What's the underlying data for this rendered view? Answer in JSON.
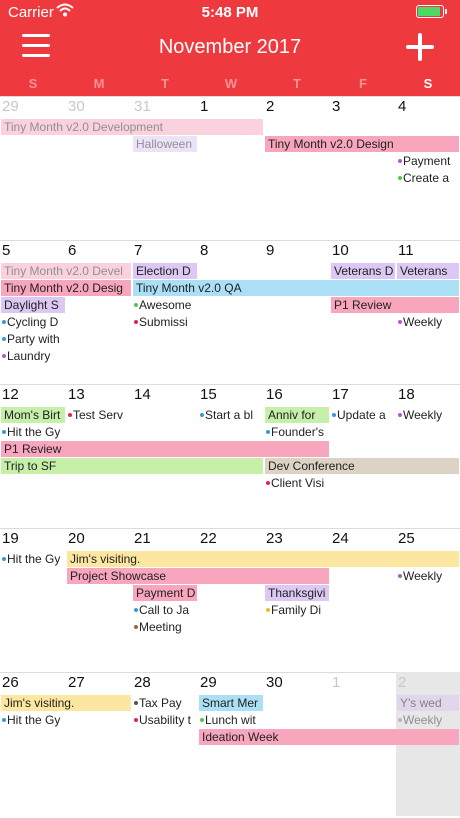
{
  "status": {
    "carrier": "Carrier",
    "time": "5:48 PM",
    "battery_level": 0.9
  },
  "header": {
    "title": "November 2017"
  },
  "weekdays": [
    "S",
    "M",
    "T",
    "W",
    "T",
    "F",
    "S"
  ],
  "colors": {
    "header": "#ee3a3e",
    "pink": "#f7a6bd",
    "purple": "#dcc8f3",
    "blue": "#aadff5",
    "green": "#c6efa9",
    "yellow": "#fbe7a0",
    "tan": "#ddd3c5",
    "dot_purple": "#b35bc9",
    "dot_green": "#4cc74d",
    "dot_blue": "#3a98d8",
    "dot_red": "#dc2755",
    "dot_gray": "#555555",
    "dot_brown": "#8a6a4a",
    "dot_yellow": "#f1b92e"
  },
  "weeks": [
    {
      "days": [
        {
          "num": "29",
          "dim": true
        },
        {
          "num": "30",
          "dim": true
        },
        {
          "num": "31",
          "dim": true
        },
        {
          "num": "1"
        },
        {
          "num": "2"
        },
        {
          "num": "3"
        },
        {
          "num": "4"
        }
      ],
      "bars": [
        {
          "label": "Tiny Month v2.0 Development",
          "start": 0,
          "span": 4,
          "row": 0,
          "color": "pink",
          "faded": true
        },
        {
          "label": "Tiny Month v2.0 Design",
          "start": 4,
          "span": 3,
          "row": 1,
          "color": "pink"
        },
        {
          "label": "Halloween",
          "start": 2,
          "span": 1,
          "row": 1,
          "color": "purple",
          "faded": true
        }
      ],
      "dots": [
        {
          "label": "Payment",
          "day": 6,
          "row": 2,
          "dot": "dot_purple"
        },
        {
          "label": "Create a",
          "day": 6,
          "row": 3,
          "dot": "dot_green"
        }
      ]
    },
    {
      "days": [
        {
          "num": "5"
        },
        {
          "num": "6"
        },
        {
          "num": "7"
        },
        {
          "num": "8"
        },
        {
          "num": "9"
        },
        {
          "num": "10"
        },
        {
          "num": "11"
        }
      ],
      "bars": [
        {
          "label": "Tiny Month v2.0 Devel",
          "start": 0,
          "span": 2,
          "row": 0,
          "color": "pink",
          "faded": true
        },
        {
          "label": "Election D",
          "start": 2,
          "span": 1,
          "row": 0,
          "color": "purple"
        },
        {
          "label": "Veterans D",
          "start": 5,
          "span": 1,
          "row": 0,
          "color": "purple"
        },
        {
          "label": "Veterans",
          "start": 6,
          "span": 1,
          "row": 0,
          "color": "purple"
        },
        {
          "label": "Tiny Month v2.0 Desig",
          "start": 0,
          "span": 2,
          "row": 1,
          "color": "pink"
        },
        {
          "label": "Tiny Month v2.0 QA",
          "start": 2,
          "span": 5,
          "row": 1,
          "color": "blue"
        },
        {
          "label": "Daylight S",
          "start": 0,
          "span": 1,
          "row": 2,
          "color": "purple"
        },
        {
          "label": "P1 Review",
          "start": 5,
          "span": 2,
          "row": 2,
          "color": "pink"
        }
      ],
      "dots": [
        {
          "label": "Awesome",
          "day": 2,
          "row": 2,
          "dot": "dot_green"
        },
        {
          "label": "Cycling D",
          "day": 0,
          "row": 3,
          "dot": "dot_blue"
        },
        {
          "label": "Submissi",
          "day": 2,
          "row": 3,
          "dot": "dot_red"
        },
        {
          "label": "Weekly",
          "day": 6,
          "row": 3,
          "dot": "dot_purple"
        },
        {
          "label": "Party with",
          "day": 0,
          "row": 4,
          "dot": "dot_blue"
        },
        {
          "label": "Laundry",
          "day": 0,
          "row": 5,
          "dot": "dot_purple"
        }
      ]
    },
    {
      "days": [
        {
          "num": "12"
        },
        {
          "num": "13"
        },
        {
          "num": "14"
        },
        {
          "num": "15"
        },
        {
          "num": "16"
        },
        {
          "num": "17"
        },
        {
          "num": "18"
        }
      ],
      "bars": [
        {
          "label": "Mom's Birt",
          "start": 0,
          "span": 1,
          "row": 0,
          "color": "green"
        },
        {
          "label": "Anniv for",
          "start": 4,
          "span": 1,
          "row": 0,
          "color": "green"
        },
        {
          "label": "P1 Review",
          "start": 0,
          "span": 5,
          "row": 2,
          "color": "pink"
        },
        {
          "label": "Trip to SF",
          "start": 0,
          "span": 4,
          "row": 3,
          "color": "green"
        },
        {
          "label": "Dev Conference",
          "start": 4,
          "span": 3,
          "row": 3,
          "color": "tan"
        }
      ],
      "dots": [
        {
          "label": "Test Serv",
          "day": 1,
          "row": 0,
          "dot": "dot_red"
        },
        {
          "label": "Start a bl",
          "day": 3,
          "row": 0,
          "dot": "dot_blue"
        },
        {
          "label": "Update a",
          "day": 5,
          "row": 0,
          "dot": "dot_blue"
        },
        {
          "label": "Weekly",
          "day": 6,
          "row": 0,
          "dot": "dot_purple"
        },
        {
          "label": "Hit the Gy",
          "day": 0,
          "row": 1,
          "dot": "dot_blue"
        },
        {
          "label": "Founder's",
          "day": 4,
          "row": 1,
          "dot": "dot_blue"
        },
        {
          "label": "Client Visi",
          "day": 4,
          "row": 4,
          "dot": "dot_red"
        }
      ]
    },
    {
      "days": [
        {
          "num": "19"
        },
        {
          "num": "20"
        },
        {
          "num": "21"
        },
        {
          "num": "22"
        },
        {
          "num": "23"
        },
        {
          "num": "24"
        },
        {
          "num": "25"
        }
      ],
      "bars": [
        {
          "label": "Jim's visiting.",
          "start": 1,
          "span": 6,
          "row": 0,
          "color": "yellow"
        },
        {
          "label": "Project Showcase",
          "start": 1,
          "span": 4,
          "row": 1,
          "color": "pink"
        },
        {
          "label": "Payment D",
          "start": 2,
          "span": 1,
          "row": 2,
          "color": "pink"
        },
        {
          "label": "Thanksgivi",
          "start": 4,
          "span": 1,
          "row": 2,
          "color": "purple"
        }
      ],
      "dots": [
        {
          "label": "Hit the Gy",
          "day": 0,
          "row": 0,
          "dot": "dot_blue"
        },
        {
          "label": "Weekly",
          "day": 6,
          "row": 1,
          "dot": "dot_purple"
        },
        {
          "label": "Call to Ja",
          "day": 2,
          "row": 3,
          "dot": "dot_blue"
        },
        {
          "label": "Family Di",
          "day": 4,
          "row": 3,
          "dot": "dot_yellow"
        },
        {
          "label": "Meeting",
          "day": 2,
          "row": 4,
          "dot": "dot_brown"
        }
      ]
    },
    {
      "days": [
        {
          "num": "26"
        },
        {
          "num": "27"
        },
        {
          "num": "28"
        },
        {
          "num": "29"
        },
        {
          "num": "30"
        },
        {
          "num": "1",
          "dim": true
        },
        {
          "num": "2",
          "dim": true,
          "selected": true
        }
      ],
      "bars": [
        {
          "label": "Jim's visiting.",
          "start": 0,
          "span": 2,
          "row": 0,
          "color": "yellow"
        },
        {
          "label": "Smart Mer",
          "start": 3,
          "span": 1,
          "row": 0,
          "color": "blue"
        },
        {
          "label": "Y's wed",
          "start": 6,
          "span": 1,
          "row": 0,
          "color": "purple",
          "faded": true
        },
        {
          "label": "Ideation Week",
          "start": 3,
          "span": 4,
          "row": 2,
          "color": "pink"
        }
      ],
      "dots": [
        {
          "label": "Tax Pay",
          "day": 2,
          "row": 0,
          "dot": "dot_gray"
        },
        {
          "label": "Hit the Gy",
          "day": 0,
          "row": 1,
          "dot": "dot_blue"
        },
        {
          "label": "Usability t",
          "day": 2,
          "row": 1,
          "dot": "dot_red"
        },
        {
          "label": "Lunch wit",
          "day": 3,
          "row": 1,
          "dot": "dot_green"
        },
        {
          "label": "Weekly",
          "day": 6,
          "row": 1,
          "dot": "dot_purple",
          "faded": true
        }
      ]
    }
  ]
}
